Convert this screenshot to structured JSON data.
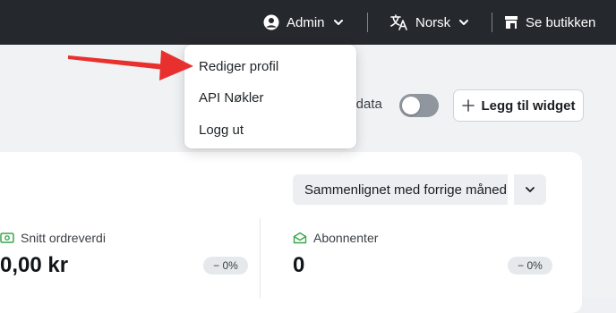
{
  "topbar": {
    "user_label": "Admin",
    "language_label": "Norsk",
    "store_label": "Se butikken"
  },
  "user_menu": {
    "items": [
      "Rediger profil",
      "API Nøkler",
      "Logg ut"
    ]
  },
  "toolbar": {
    "toggle_label_partial": "stdata",
    "toggle_on": false,
    "add_widget_label": "Legg til widget"
  },
  "comparison": {
    "selected": "Sammenlignet med forrige måned"
  },
  "metrics": [
    {
      "label": "Snitt ordreverdi",
      "value": "0,00 kr",
      "change": "− 0%",
      "icon": "money-icon"
    },
    {
      "label": "Abonnenter",
      "value": "0",
      "change": "− 0%",
      "icon": "envelope-icon"
    }
  ],
  "colors": {
    "topbar": "#25292e",
    "annotation_arrow": "#e8312f",
    "metric_icon": "#3aa64d"
  }
}
